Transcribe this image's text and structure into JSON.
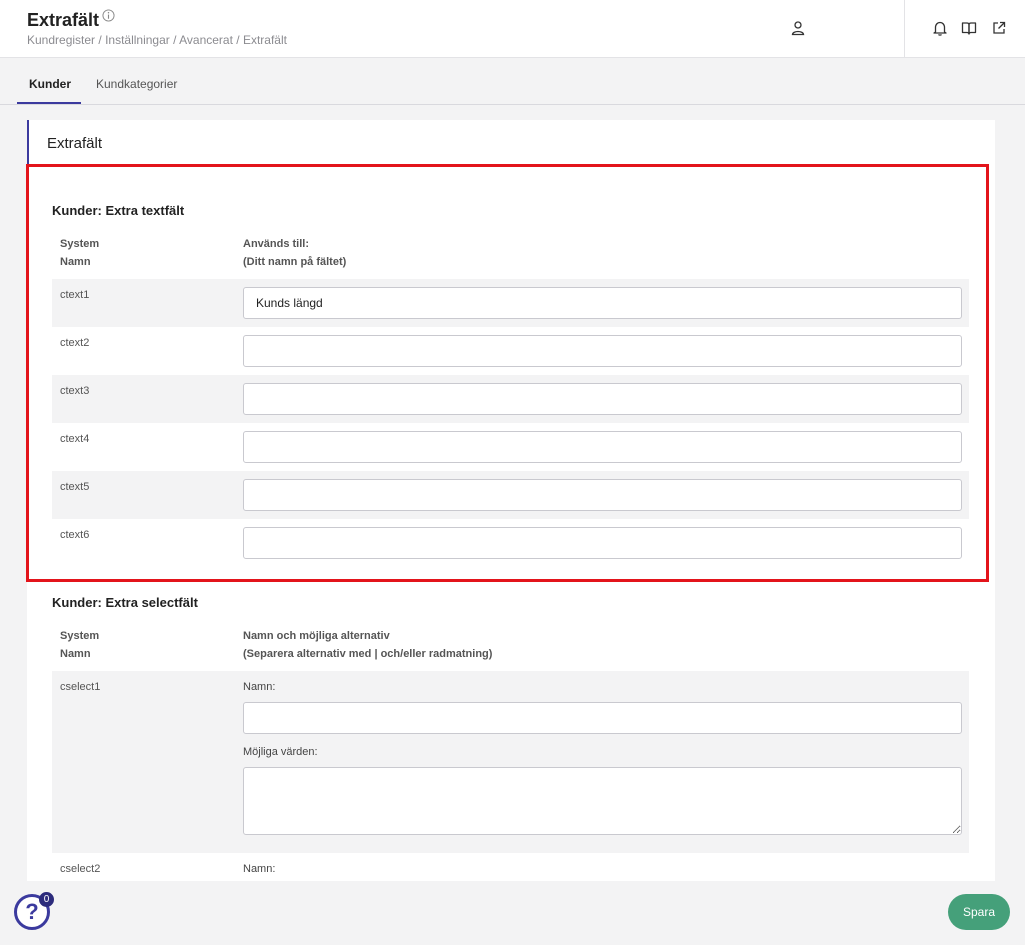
{
  "header": {
    "title": "Extrafält",
    "breadcrumb": [
      "Kundregister",
      "Inställningar",
      "Avancerat",
      "Extrafält"
    ],
    "breadcrumb_sep": " / "
  },
  "tabs": [
    {
      "label": "Kunder",
      "active": true
    },
    {
      "label": "Kundkategorier",
      "active": false
    }
  ],
  "card": {
    "title": "Extrafält",
    "text_section": {
      "title": "Kunder: Extra textfält",
      "col1": [
        "System",
        "Namn"
      ],
      "col2": [
        "Används till:",
        "(Ditt namn på fältet)"
      ],
      "rows": [
        {
          "system": "ctext1",
          "value": "Kunds längd"
        },
        {
          "system": "ctext2",
          "value": ""
        },
        {
          "system": "ctext3",
          "value": ""
        },
        {
          "system": "ctext4",
          "value": ""
        },
        {
          "system": "ctext5",
          "value": ""
        },
        {
          "system": "ctext6",
          "value": ""
        }
      ]
    },
    "select_section": {
      "title": "Kunder: Extra selectfält",
      "col1": [
        "System",
        "Namn"
      ],
      "col2": [
        "Namn och möjliga alternativ",
        "(Separera alternativ med | och/eller radmatning)"
      ],
      "rows": [
        {
          "system": "cselect1",
          "name_label": "Namn:",
          "values_label": "Möjliga värden:",
          "name_value": "",
          "values_value": ""
        },
        {
          "system": "cselect2",
          "name_label": "Namn:"
        }
      ]
    }
  },
  "help": {
    "symbol": "?",
    "badge": "0"
  },
  "save_label": "Spara",
  "colors": {
    "accent": "#3b3a9e",
    "save": "#45a07a",
    "highlight": "#e3141b",
    "row_shade": "#f3f3f4"
  },
  "icons": [
    "info-icon",
    "user-icon",
    "bell-icon",
    "book-icon",
    "external-link-icon",
    "help-icon"
  ]
}
